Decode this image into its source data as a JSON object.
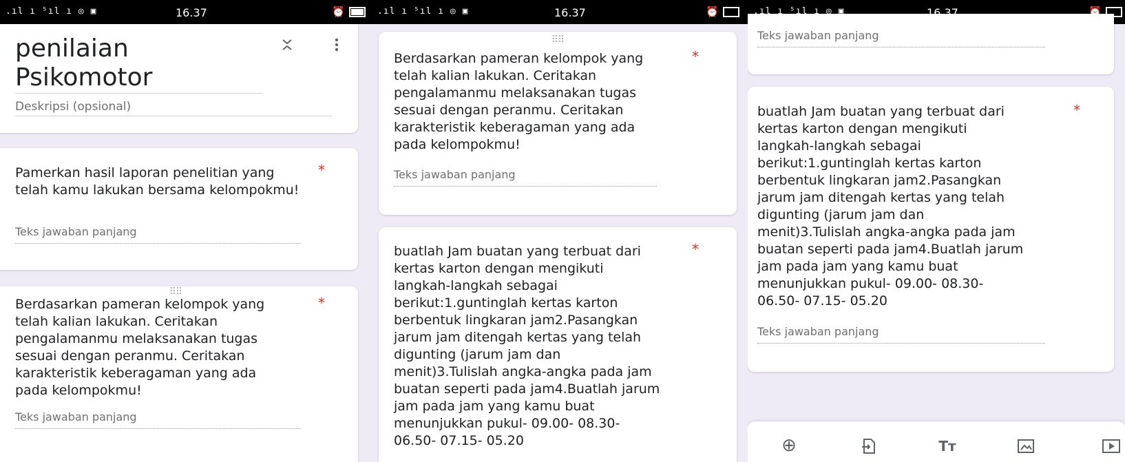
{
  "status_bar": {
    "signal": ".ıl ı ⁵ıl ı ◎ ▣",
    "time": "16.37",
    "alarm": "⏰"
  },
  "form": {
    "title_line1": "penilaian",
    "title_line2": "Psikomotor",
    "description_placeholder": "Deskripsi (opsional)"
  },
  "questions": {
    "q1": "Pamerkan hasil  laporan penelitian yang telah kamu lakukan bersama kelompokmu!",
    "q2_lines": [
      "Berdasarkan pameran kelompok yang",
      "telah kalian lakukan. Ceritakan",
      "pengalamanmu melaksanakan tugas",
      "sesuai dengan peranmu. Ceritakan",
      "karakteristik keberagaman yang ada",
      "pada kelompokmu!"
    ],
    "q3_lines": [
      "buatlah Jam buatan yang terbuat dari",
      "kertas karton dengan mengikuti",
      "langkah-langkah sebagai",
      "berikut:1.guntinglah kertas karton",
      "berbentuk lingkaran jam2.Pasangkan",
      "jarum jam ditengah kertas yang telah",
      "digunting (jarum jam dan",
      "menit)3.Tulislah angka-angka pada jam",
      "buatan seperti pada jam4.Buatlah jarum",
      "jam pada jam yang kamu buat",
      "menunjukkan pukul- 09.00- 08.30-",
      "06.50- 07.15- 05.20"
    ]
  },
  "required_mark": "*",
  "answer_hint": "Teks jawaban panjang",
  "drag_handle": "⠿⠿",
  "icons": {
    "collapse": "collapse-icon",
    "more": "more-vert-icon",
    "add": "add-circle-icon",
    "import": "import-icon",
    "title": "title-text-icon",
    "image": "image-icon",
    "video": "video-icon"
  },
  "toolbar_glyphs": {
    "add": "⊕",
    "title": "Tт"
  },
  "colors": {
    "background": "#eeeaf6",
    "required": "#d93025",
    "hint": "#6f6f6f"
  }
}
